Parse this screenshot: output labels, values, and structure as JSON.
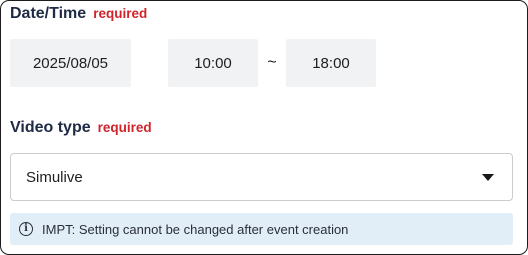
{
  "datetime": {
    "label": "Date/Time",
    "required": "required",
    "date": "2025/08/05",
    "start_time": "10:00",
    "separator": "~",
    "end_time": "18:00"
  },
  "video_type": {
    "label": "Video type",
    "required": "required",
    "selected": "Simulive",
    "caret_icon": "caret-down-icon"
  },
  "notice": {
    "icon": "info-icon",
    "text": "IMPT: Setting cannot be changed after event creation"
  },
  "colors": {
    "label": "#1f2a44",
    "required": "#d0242b",
    "pill_bg": "#f1f2f4",
    "notice_bg": "#e1eef8",
    "select_border": "#c9ccd1"
  }
}
